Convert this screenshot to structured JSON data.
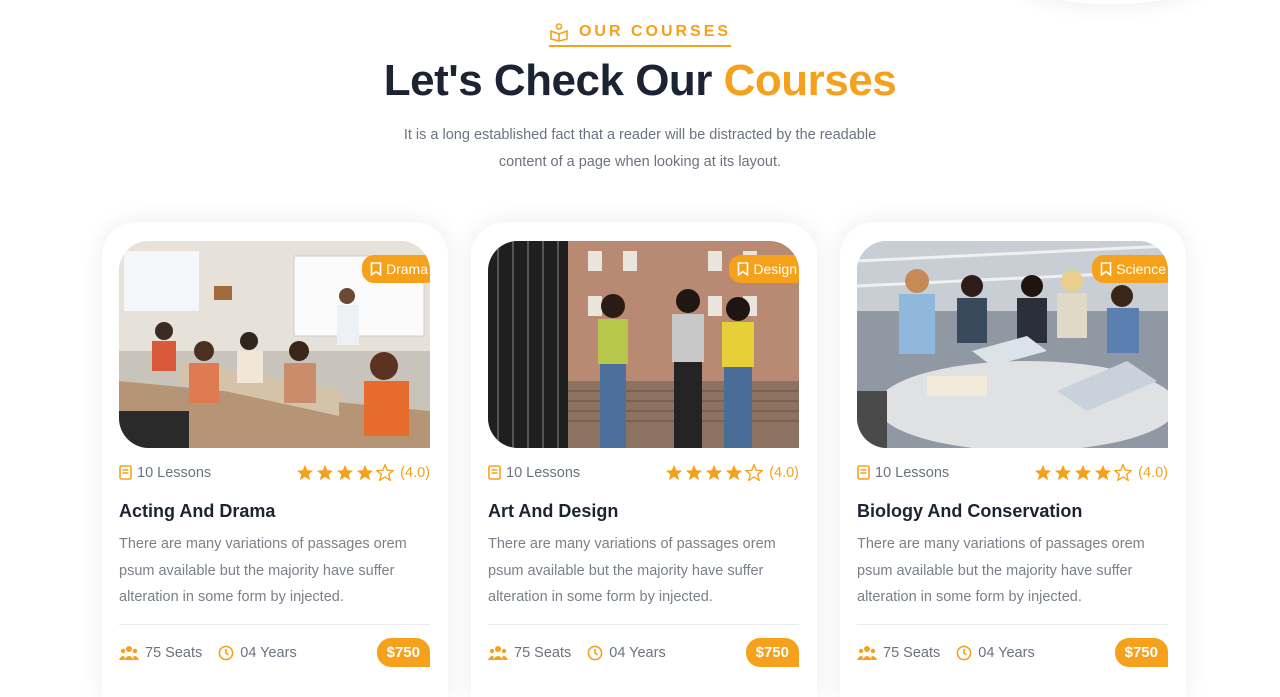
{
  "header": {
    "eyebrow": "OUR COURSES",
    "title_main": "Let's Check Our ",
    "title_accent": "Courses",
    "subtitle": "It is a long established fact that a reader will be distracted by the readable content of a page when looking at its layout."
  },
  "colors": {
    "accent": "#f6a11b",
    "heading": "#1c2433",
    "muted": "#6b7280"
  },
  "courses": [
    {
      "tag": "Drama",
      "lessons": "10 Lessons",
      "stars": 4,
      "rating": "(4.0)",
      "title": "Acting And Drama",
      "description": "There are many variations of passages orem psum available but the majority have suffer alteration in some form by injected.",
      "seats": "75 Seats",
      "years": "04 Years",
      "price": "$750"
    },
    {
      "tag": "Design",
      "lessons": "10 Lessons",
      "stars": 4,
      "rating": "(4.0)",
      "title": "Art And Design",
      "description": "There are many variations of passages orem psum available but the majority have suffer alteration in some form by injected.",
      "seats": "75 Seats",
      "years": "04 Years",
      "price": "$750"
    },
    {
      "tag": "Science",
      "lessons": "10 Lessons",
      "stars": 4,
      "rating": "(4.0)",
      "title": "Biology And Conservation",
      "description": "There are many variations of passages orem psum available but the majority have suffer alteration in some form by injected.",
      "seats": "75 Seats",
      "years": "04 Years",
      "price": "$750"
    }
  ]
}
